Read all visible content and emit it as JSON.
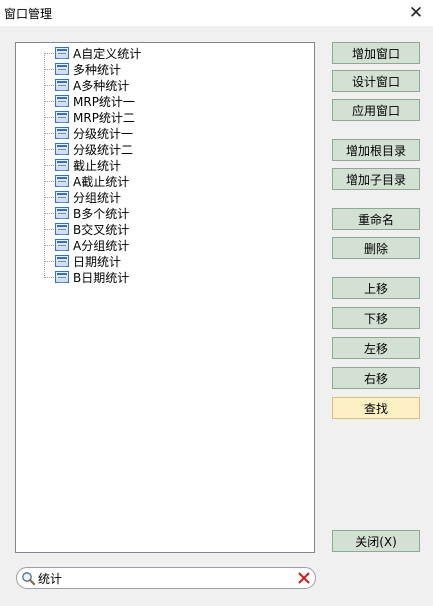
{
  "window": {
    "title": "窗口管理",
    "close_icon": "close-icon"
  },
  "tree": {
    "items": [
      "A自定义统计",
      "多种统计",
      "A多种统计",
      "MRP统计一",
      "MRP统计二",
      "分级统计一",
      "分级统计二",
      "截止统计",
      "A截止统计",
      "分组统计",
      "B多个统计",
      "B交叉统计",
      "A分组统计",
      "日期统计",
      "B日期统计"
    ]
  },
  "buttons": {
    "add_window": "增加窗口",
    "design_window": "设计窗口",
    "apply_window": "应用窗口",
    "add_root_dir": "增加根目录",
    "add_sub_dir": "增加子目录",
    "rename": "重命名",
    "delete": "删除",
    "move_up": "上移",
    "move_down": "下移",
    "move_left": "左移",
    "move_right": "右移",
    "find": "查找",
    "close": "关闭(X)"
  },
  "search": {
    "value": "统计"
  },
  "colors": {
    "button_bg": "#d3e1d5",
    "highlight_bg": "#fdf0c4",
    "clear_icon": "#d0201a"
  }
}
